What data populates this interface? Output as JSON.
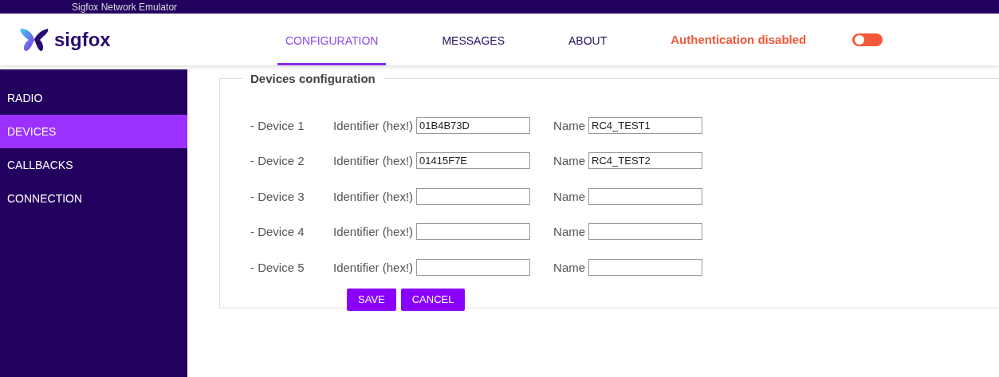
{
  "window": {
    "title": "Sigfox Network Emulator"
  },
  "header": {
    "logo": "sigfox",
    "tabs": [
      {
        "label": "CONFIGURATION",
        "selected": true
      },
      {
        "label": "MESSAGES",
        "selected": false
      },
      {
        "label": "ABOUT",
        "selected": false
      }
    ],
    "auth_status": "Authentication disabled",
    "auth_toggle": {
      "on": false
    }
  },
  "sidebar": {
    "items": [
      {
        "label": "RADIO",
        "selected": false
      },
      {
        "label": "DEVICES",
        "selected": true
      },
      {
        "label": "CALLBACKS",
        "selected": false
      },
      {
        "label": "CONNECTION",
        "selected": false
      }
    ]
  },
  "form": {
    "title": "Devices configuration",
    "devices": [
      {
        "label": "- Device 1",
        "identifier_label": "Identifier (hex!)",
        "identifier": "01B4B73D",
        "name_label": "Name",
        "name": "RC4_TEST1"
      },
      {
        "label": "- Device 2",
        "identifier_label": "Identifier (hex!)",
        "identifier": "01415F7E",
        "name_label": "Name",
        "name": "RC4_TEST2"
      },
      {
        "label": "- Device 3",
        "identifier_label": "Identifier (hex!)",
        "name_label": "Name"
      },
      {
        "label": "- Device 4",
        "identifier_label": "Identifier (hex!)",
        "name_label": "Name"
      },
      {
        "label": "- Device 5",
        "identifier_label": "Identifier (hex!)",
        "name_label": "Name"
      }
    ],
    "buttons": [
      "SAVE",
      "CANCEL"
    ]
  }
}
